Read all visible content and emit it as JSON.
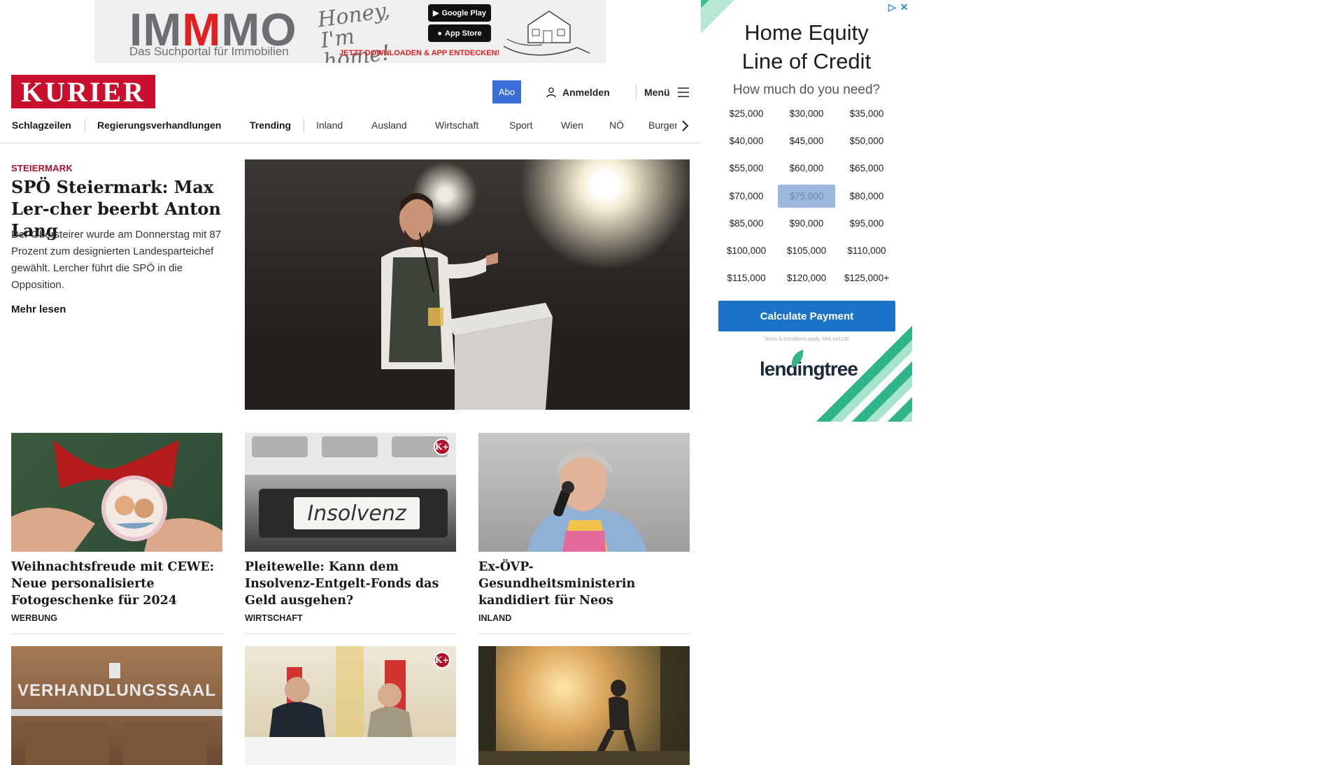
{
  "top_ad": {
    "brand_a": "IM",
    "brand_b": "M",
    "brand_c": "MO",
    "script": "Honey, I'm home!",
    "tagline": "Das Suchportal für Immobilien",
    "cta": "JETZT DOWNLOADEN & APP ENTDECKEN!",
    "store_google": "Google Play",
    "store_apple": "App Store"
  },
  "header": {
    "logo": "KURIER",
    "abo": "Abo",
    "login": "Anmelden",
    "menu": "Menü"
  },
  "nav": {
    "items": [
      "Schlagzeilen",
      "Regierungsverhandlungen",
      "Trending",
      "Inland",
      "Ausland",
      "Wirtschaft",
      "Sport",
      "Wien",
      "NÖ",
      "Burgenl"
    ]
  },
  "lead": {
    "kicker": "STEIERMARK",
    "title": "SPÖ Steiermark: Max Ler-cher beerbt Anton Lang",
    "text": "Der Obersteirer wurde am Donnerstag mit 87 Prozent zum designierten Landesparteichef gewählt. Lercher führt die SPÖ in die Opposition.",
    "more": "Mehr lesen"
  },
  "cards_row1": [
    {
      "title": "Weihnachtsfreude mit CEWE: Neue personalisierte Fotogeschenke für 2024",
      "section": "WERBUNG",
      "plus": false
    },
    {
      "title": "Pleitewelle: Kann dem Insolvenz-Entgelt-Fonds das Geld ausgehen?",
      "section": "WIRTSCHAFT",
      "plus": true,
      "image_text": "Insolvenz"
    },
    {
      "title": "Ex-ÖVP-Gesundheitsministerin kandidiert für Neos",
      "section": "INLAND",
      "plus": false
    }
  ],
  "cards_row2": [
    {
      "image_text": "VERHANDLUNGSSAAL",
      "plus": false
    },
    {
      "plus": true
    },
    {
      "plus": false
    }
  ],
  "kplus_label": "K+",
  "side_ad": {
    "headline_1": "Home Equity",
    "headline_2": "Line of Credit",
    "question": "How much do you need?",
    "amounts": [
      "$25,000",
      "$30,000",
      "$35,000",
      "$40,000",
      "$45,000",
      "$50,000",
      "$55,000",
      "$60,000",
      "$65,000",
      "$70,000",
      "$75,000",
      "$80,000",
      "$85,000",
      "$90,000",
      "$95,000",
      "$100,000",
      "$105,000",
      "$110,000",
      "$115,000",
      "$120,000",
      "$125,000+"
    ],
    "selected": "$75,000",
    "button": "Calculate Payment",
    "terms": "Terms & Conditions apply. NMLS#1136",
    "logo": "lendingtree"
  },
  "colors": {
    "kurier_red": "#c8102e",
    "abo_blue": "#3a6fd8",
    "lendingtree_green": "#2fb58a",
    "calc_button": "#1a73c8"
  }
}
